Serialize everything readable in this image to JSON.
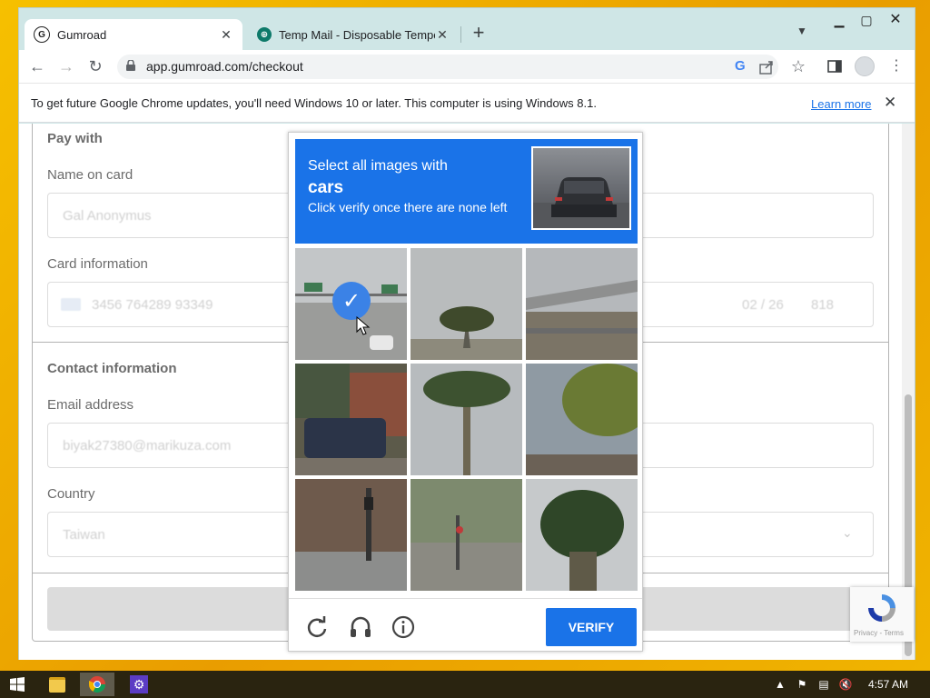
{
  "browser": {
    "tabs": [
      {
        "title": "Gumroad",
        "favicon": "G",
        "active": true
      },
      {
        "title": "Temp Mail - Disposable Tempora",
        "favicon": "⊕",
        "active": false
      }
    ],
    "url": "app.gumroad.com/checkout",
    "infobar": {
      "text": "To get future Google Chrome updates, you'll need Windows 10 or later. This computer is using Windows 8.1.",
      "link": "Learn more"
    }
  },
  "form": {
    "pay_with": "Pay with",
    "name_on_card_label": "Name on card",
    "name_on_card_value": "Gal Anonymus",
    "card_info_label": "Card information",
    "card_number": "3456 764289 93349",
    "card_expiry": "02 / 26",
    "card_cvc": "818",
    "contact_header": "Contact information",
    "email_label": "Email address",
    "email_value": "biyak27380@marikuza.com",
    "country_label": "Country",
    "country_value": "Taiwan"
  },
  "captcha": {
    "line1": "Select all images with",
    "object": "cars",
    "line3": "Click verify once there are none left",
    "verify_label": "VERIFY",
    "selected_tile": 0
  },
  "recaptcha_badge": {
    "terms": "Privacy - Terms"
  },
  "taskbar": {
    "time": "4:57 AM"
  },
  "colors": {
    "accent": "#1a73e8",
    "taskbar": "#2a2410"
  }
}
